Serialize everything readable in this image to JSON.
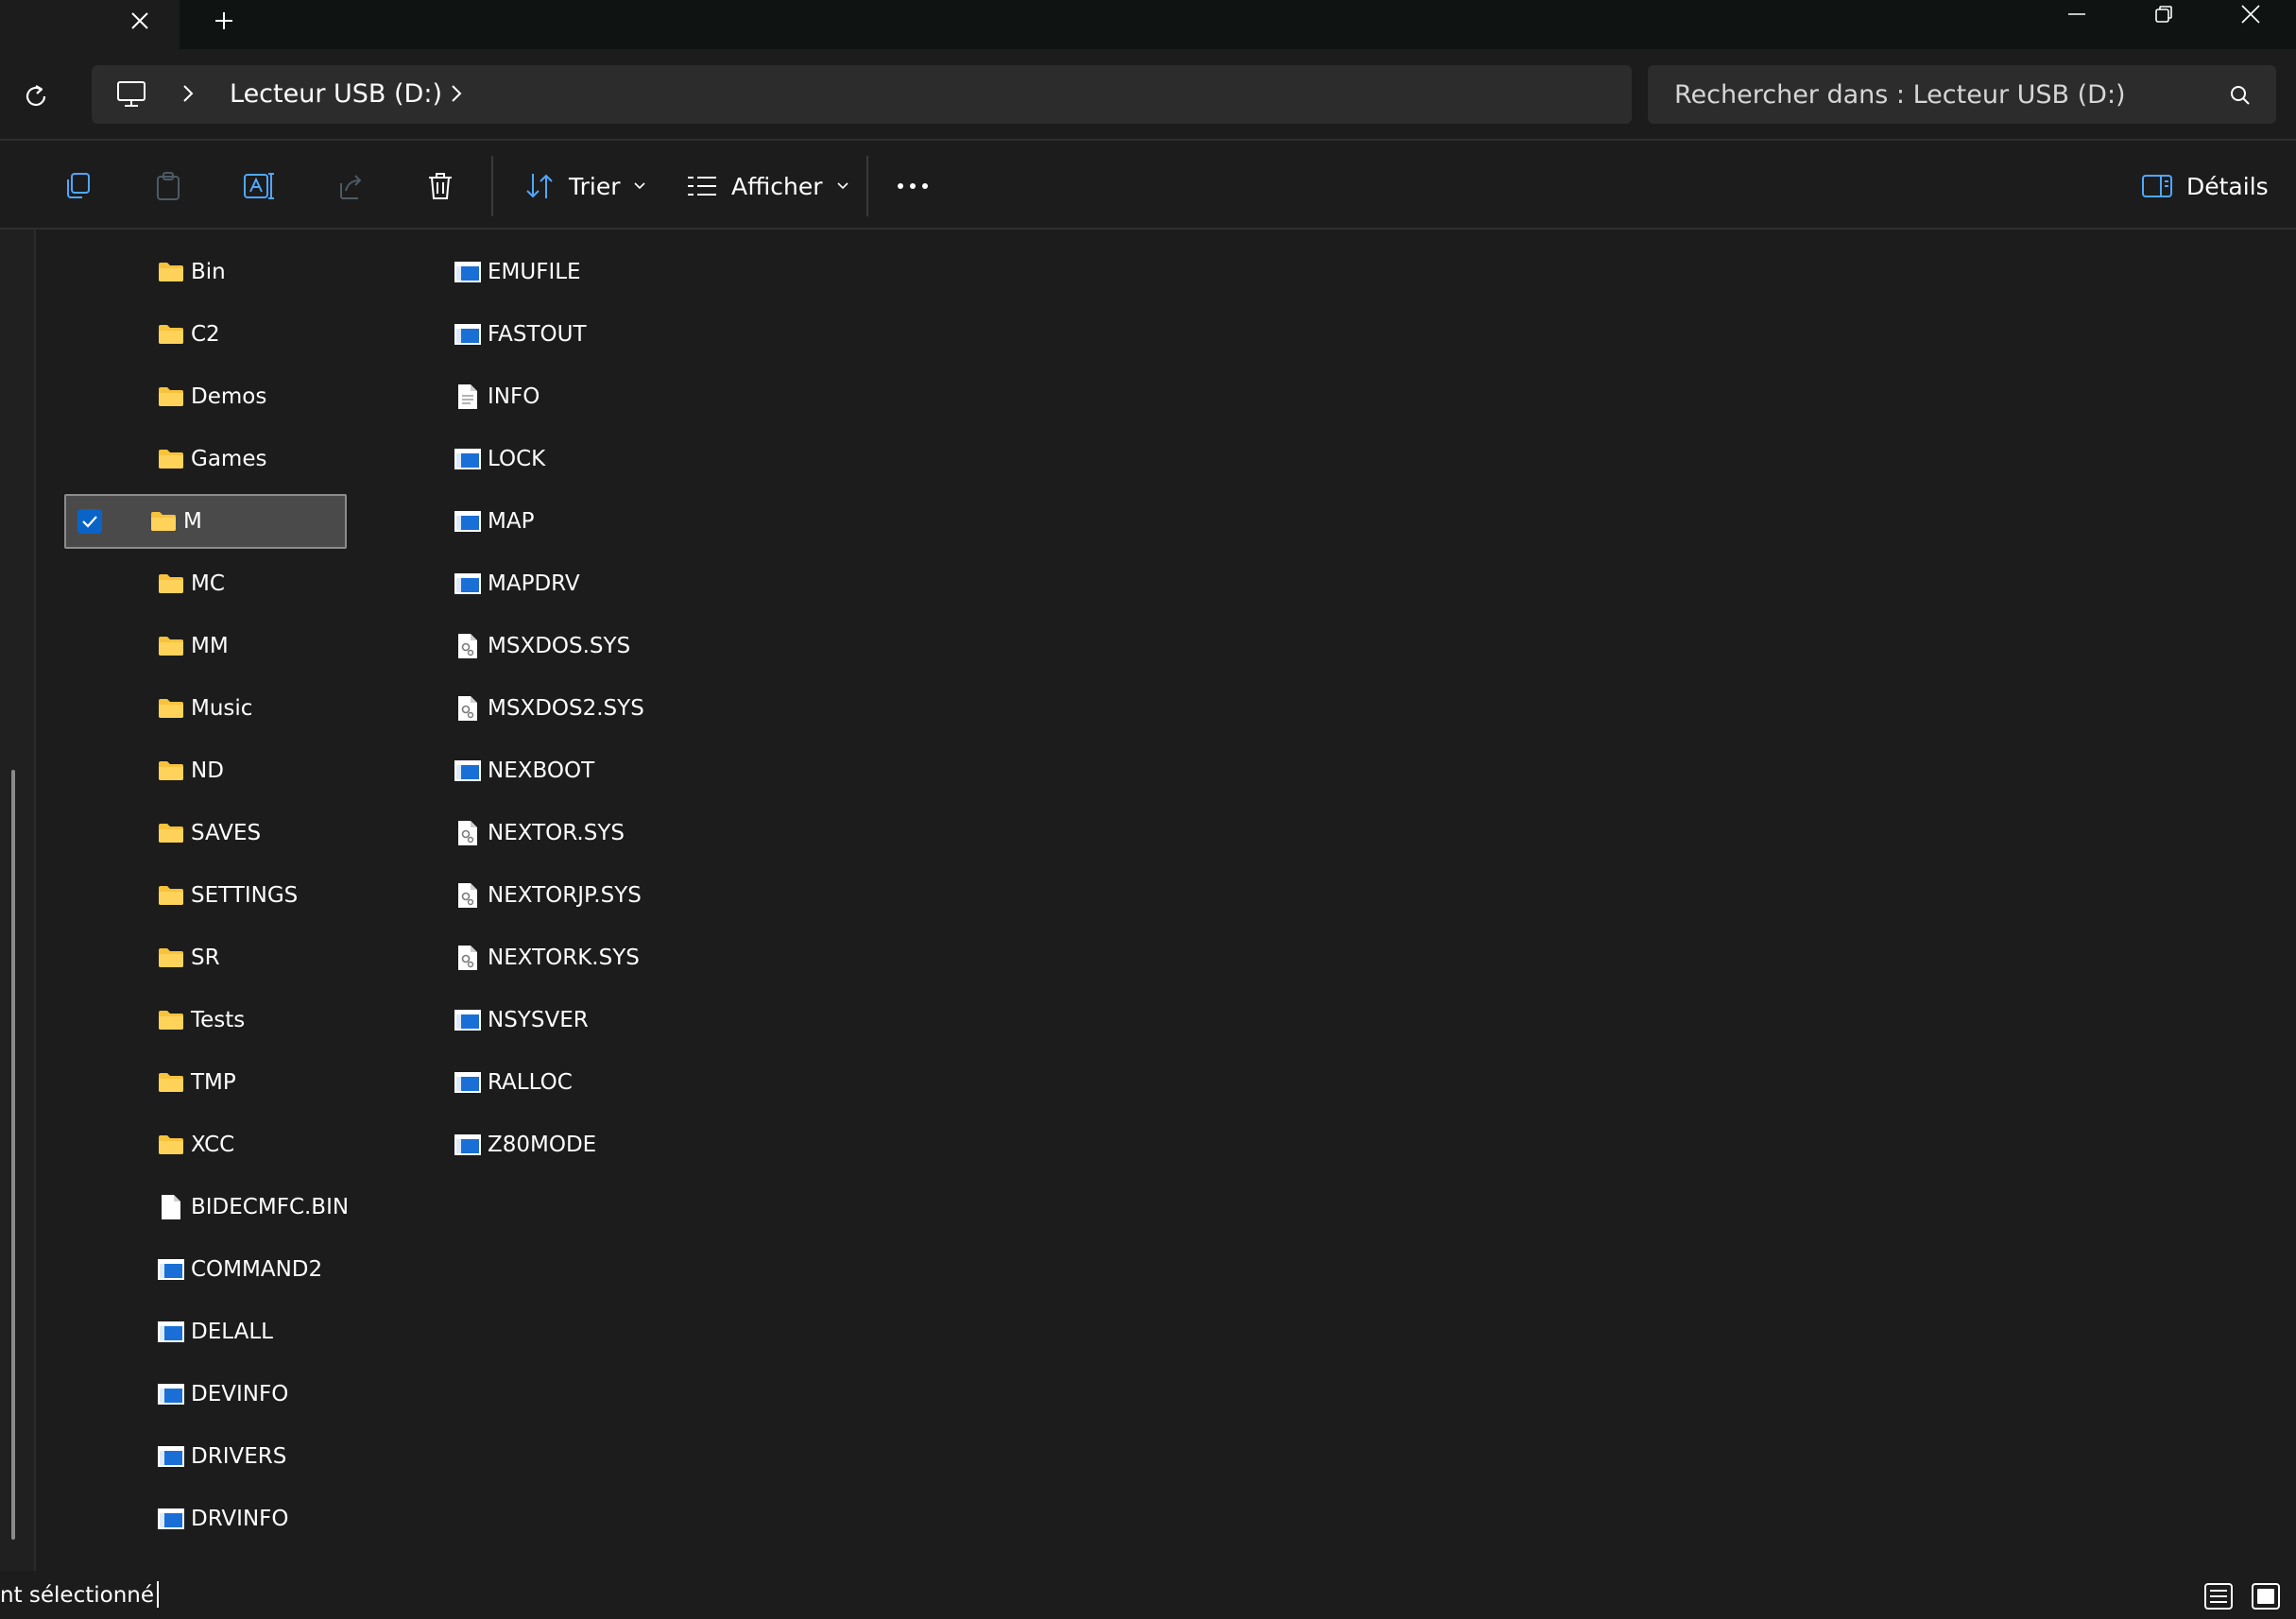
{
  "window": {
    "tab_close_icon": "close-icon",
    "new_tab_icon": "plus-icon"
  },
  "address": {
    "crumb": "Lecteur USB (D:)"
  },
  "search": {
    "placeholder": "Rechercher dans : Lecteur USB (D:)"
  },
  "toolbar": {
    "sort_label": "Trier",
    "view_label": "Afficher",
    "details_label": "Détails"
  },
  "files": {
    "column1": [
      {
        "name": "Bin",
        "icon": "folder-icon"
      },
      {
        "name": "C2",
        "icon": "folder-icon"
      },
      {
        "name": "Demos",
        "icon": "folder-icon"
      },
      {
        "name": "Games",
        "icon": "folder-icon"
      },
      {
        "name": "M",
        "icon": "folder-icon",
        "selected": true
      },
      {
        "name": "MC",
        "icon": "folder-icon"
      },
      {
        "name": "MM",
        "icon": "folder-icon"
      },
      {
        "name": "Music",
        "icon": "folder-icon"
      },
      {
        "name": "ND",
        "icon": "folder-icon"
      },
      {
        "name": "SAVES",
        "icon": "folder-icon"
      },
      {
        "name": "SETTINGS",
        "icon": "folder-icon"
      },
      {
        "name": "SR",
        "icon": "folder-icon"
      },
      {
        "name": "Tests",
        "icon": "folder-icon"
      },
      {
        "name": "TMP",
        "icon": "folder-icon"
      },
      {
        "name": "XCC",
        "icon": "folder-icon"
      },
      {
        "name": "BIDECMFC.BIN",
        "icon": "document-icon"
      },
      {
        "name": "COMMAND2",
        "icon": "application-icon"
      },
      {
        "name": "DELALL",
        "icon": "application-icon"
      },
      {
        "name": "DEVINFO",
        "icon": "application-icon"
      },
      {
        "name": "DRIVERS",
        "icon": "application-icon"
      },
      {
        "name": "DRVINFO",
        "icon": "application-icon"
      }
    ],
    "column2": [
      {
        "name": "EMUFILE",
        "icon": "application-icon"
      },
      {
        "name": "FASTOUT",
        "icon": "application-icon"
      },
      {
        "name": "INFO",
        "icon": "text-document-icon"
      },
      {
        "name": "LOCK",
        "icon": "application-icon"
      },
      {
        "name": "MAP",
        "icon": "application-icon"
      },
      {
        "name": "MAPDRV",
        "icon": "application-icon"
      },
      {
        "name": "MSXDOS.SYS",
        "icon": "system-file-icon"
      },
      {
        "name": "MSXDOS2.SYS",
        "icon": "system-file-icon"
      },
      {
        "name": "NEXBOOT",
        "icon": "application-icon"
      },
      {
        "name": "NEXTOR.SYS",
        "icon": "system-file-icon"
      },
      {
        "name": "NEXTORJP.SYS",
        "icon": "system-file-icon"
      },
      {
        "name": "NEXTORK.SYS",
        "icon": "system-file-icon"
      },
      {
        "name": "NSYSVER",
        "icon": "application-icon"
      },
      {
        "name": "RALLOC",
        "icon": "application-icon"
      },
      {
        "name": "Z80MODE",
        "icon": "application-icon"
      }
    ]
  },
  "status": {
    "text": "nt sélectionné"
  },
  "colors": {
    "background": "#1c1c1c",
    "titlebar": "#0f1412",
    "field": "#2c2c2c",
    "folder": "#f8c33c",
    "accent": "#0a64c8",
    "selection": "#4a4a4a"
  }
}
